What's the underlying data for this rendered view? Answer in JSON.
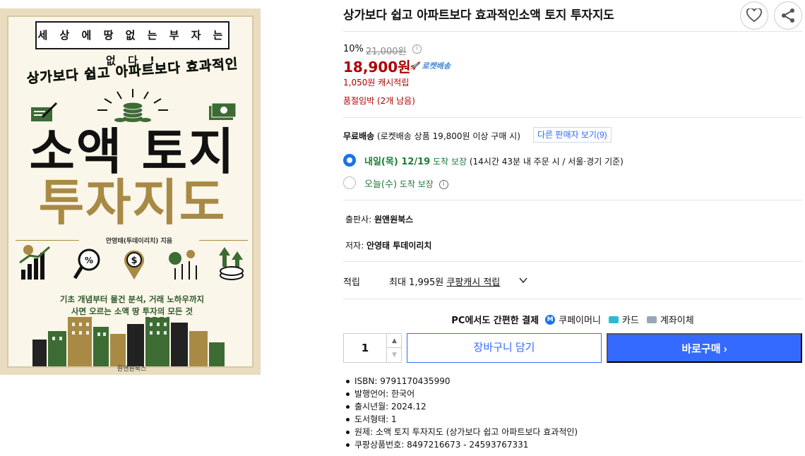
{
  "cover": {
    "top_banner": "세 상 에   땅   없 는   부 자 는   없 다 !",
    "arc_text": "상가보다 쉽고 아파트보다 효과적인",
    "title_line1": "소액 토지",
    "title_line2": "투자지도",
    "author": "안영태(투데이리치) 지음",
    "subtitle_line1": "기초 개념부터 물건 분석, 거래 노하우까지",
    "subtitle_line2": "사면 오르는 소액 땅 투자의 모든 것",
    "publisher_logo": "원앤원북스"
  },
  "product": {
    "title": "상가보다 쉽고 아파트보다 효과적인소액 토지 투자지도",
    "discount_rate": "10%",
    "original_price": "21,000원",
    "price": "18,900원",
    "rocket_badge": "로켓배송",
    "cash_reward": "1,050원 캐시적립",
    "stock_notice": "품절임박 (2개 남음)"
  },
  "shipping": {
    "free_label": "무료배송",
    "free_condition": "(로켓배송 상품 19,800원 이상 구매 시)",
    "other_sellers_button": "다른 판매자 보기(9)",
    "options": [
      {
        "date": "내일(목) 12/19",
        "suffix": "도착 보장",
        "note": "(14시간 43분 내 주문 시 / 서울·경기 기준)",
        "selected": true
      },
      {
        "date": "오늘(수)",
        "suffix": "도착 보장",
        "note": "",
        "selected": false
      }
    ]
  },
  "meta": {
    "publisher_label": "출판사:",
    "publisher": "원앤원북스",
    "author_label": "저자:",
    "author": "안영태 투데이리치"
  },
  "points": {
    "label": "적립",
    "prefix": "최대 1,995원",
    "link": "쿠팡캐시 적립"
  },
  "payment": {
    "label": "PC에서도 간편한 결제",
    "methods": [
      "쿠페이머니",
      "카드",
      "계좌이체"
    ]
  },
  "purchase": {
    "quantity": "1",
    "cart_button": "장바구니 담기",
    "buy_button": "바로구매"
  },
  "specs": [
    "ISBN: 9791170435990",
    "발행언어: 한국어",
    "출시년월: 2024.12",
    "도서형태: 1",
    "원제: 소액 토지 투자지도 (상가보다 쉽고 아파트보다 효과적인)",
    "쿠팡상품번호: 8497216673 - 24593767331"
  ],
  "colors": {
    "price_red": "#ae0000",
    "accent_blue": "#346aff",
    "delivery_green": "#1f7c37",
    "cover_gold": "#a88a45"
  }
}
